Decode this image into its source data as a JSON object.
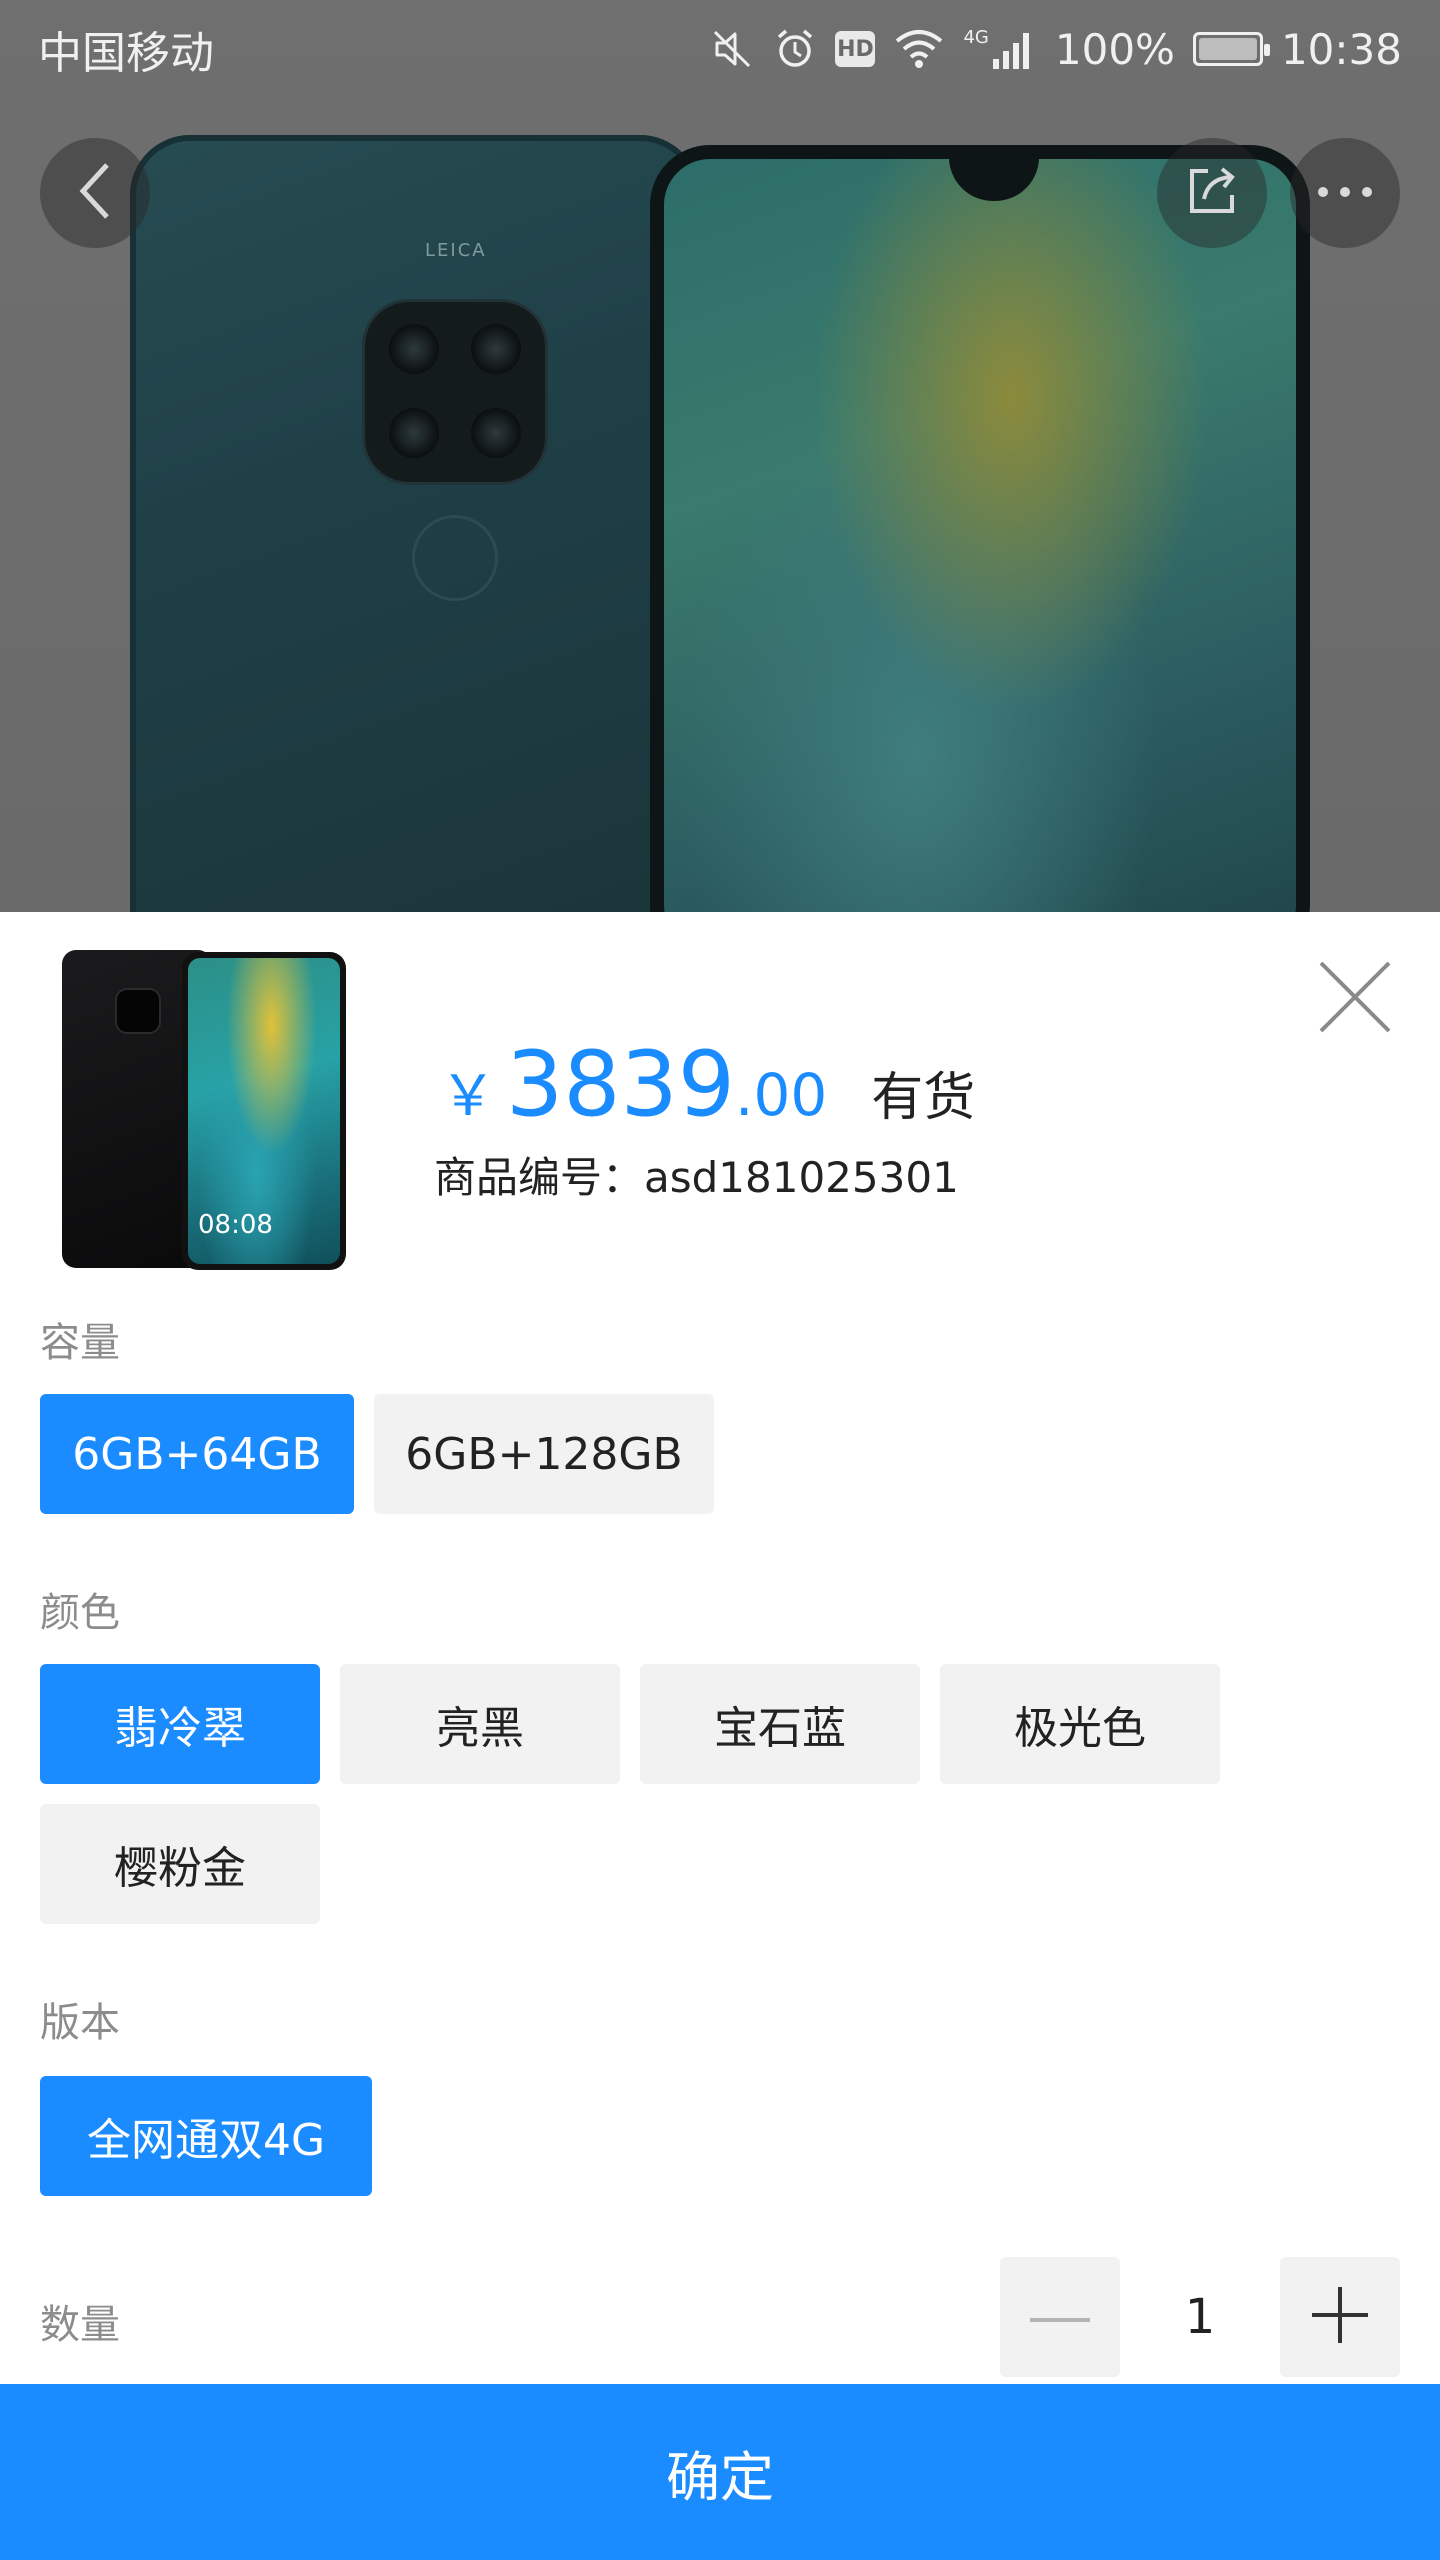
{
  "status_bar": {
    "carrier": "中国移动",
    "network": "4G",
    "battery_percent": "100%",
    "time": "10:38",
    "hd_label": "HD",
    "battery_level": 1.0
  },
  "hero": {
    "back_icon": "chevron-left-icon",
    "share_icon": "share-icon",
    "more_icon": "more-dots-icon",
    "brand_on_device": "LEICA"
  },
  "product": {
    "price_symbol": "￥",
    "price_integer": "3839",
    "price_decimal": ".00",
    "stock_status": "有货",
    "sku_label": "商品编号：",
    "sku_value": "asd181025301",
    "thumb_time": "08:08"
  },
  "options": {
    "capacity": {
      "label": "容量",
      "items": [
        "6GB+64GB",
        "6GB+128GB"
      ],
      "selected": "6GB+64GB"
    },
    "color": {
      "label": "颜色",
      "items": [
        "翡冷翠",
        "亮黑",
        "宝石蓝",
        "极光色",
        "樱粉金"
      ],
      "selected": "翡冷翠"
    },
    "version": {
      "label": "版本",
      "items": [
        "全网通双4G"
      ],
      "selected": "全网通双4G"
    }
  },
  "quantity": {
    "label": "数量",
    "value": "1"
  },
  "confirm_label": "确定",
  "colors": {
    "accent": "#1a8cff",
    "option_bg": "#f2f2f2",
    "label_gray": "#8c8c8c"
  }
}
